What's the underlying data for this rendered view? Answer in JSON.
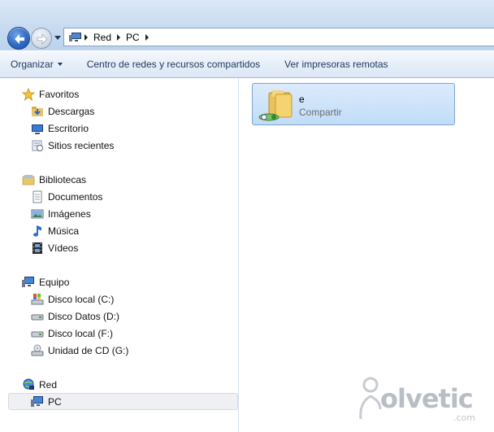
{
  "address": {
    "segments": [
      "Red",
      "PC"
    ],
    "icon": "network-computer-icon"
  },
  "toolbar": {
    "organize": "Organizar",
    "network_center": "Centro de redes y recursos compartidos",
    "printers": "Ver impresoras remotas"
  },
  "nav": {
    "favorites": {
      "label": "Favoritos",
      "items": [
        "Descargas",
        "Escritorio",
        "Sitios recientes"
      ]
    },
    "libraries": {
      "label": "Bibliotecas",
      "items": [
        "Documentos",
        "Imágenes",
        "Música",
        "Vídeos"
      ]
    },
    "computer": {
      "label": "Equipo",
      "items": [
        "Disco local (C:)",
        "Disco Datos (D:)",
        "Disco local (F:)",
        "Unidad de CD (G:)"
      ]
    },
    "network": {
      "label": "Red",
      "items": [
        "PC"
      ],
      "selected": "PC"
    }
  },
  "content": {
    "items": [
      {
        "name": "e",
        "type": "Compartir",
        "icon": "shared-folder-icon"
      }
    ]
  },
  "watermark": {
    "text": "olvetic",
    "domain": ".com"
  },
  "colors": {
    "accent": "#3a74c8",
    "selection": "#c1dcf8",
    "toolbar_text": "#1e395b"
  }
}
